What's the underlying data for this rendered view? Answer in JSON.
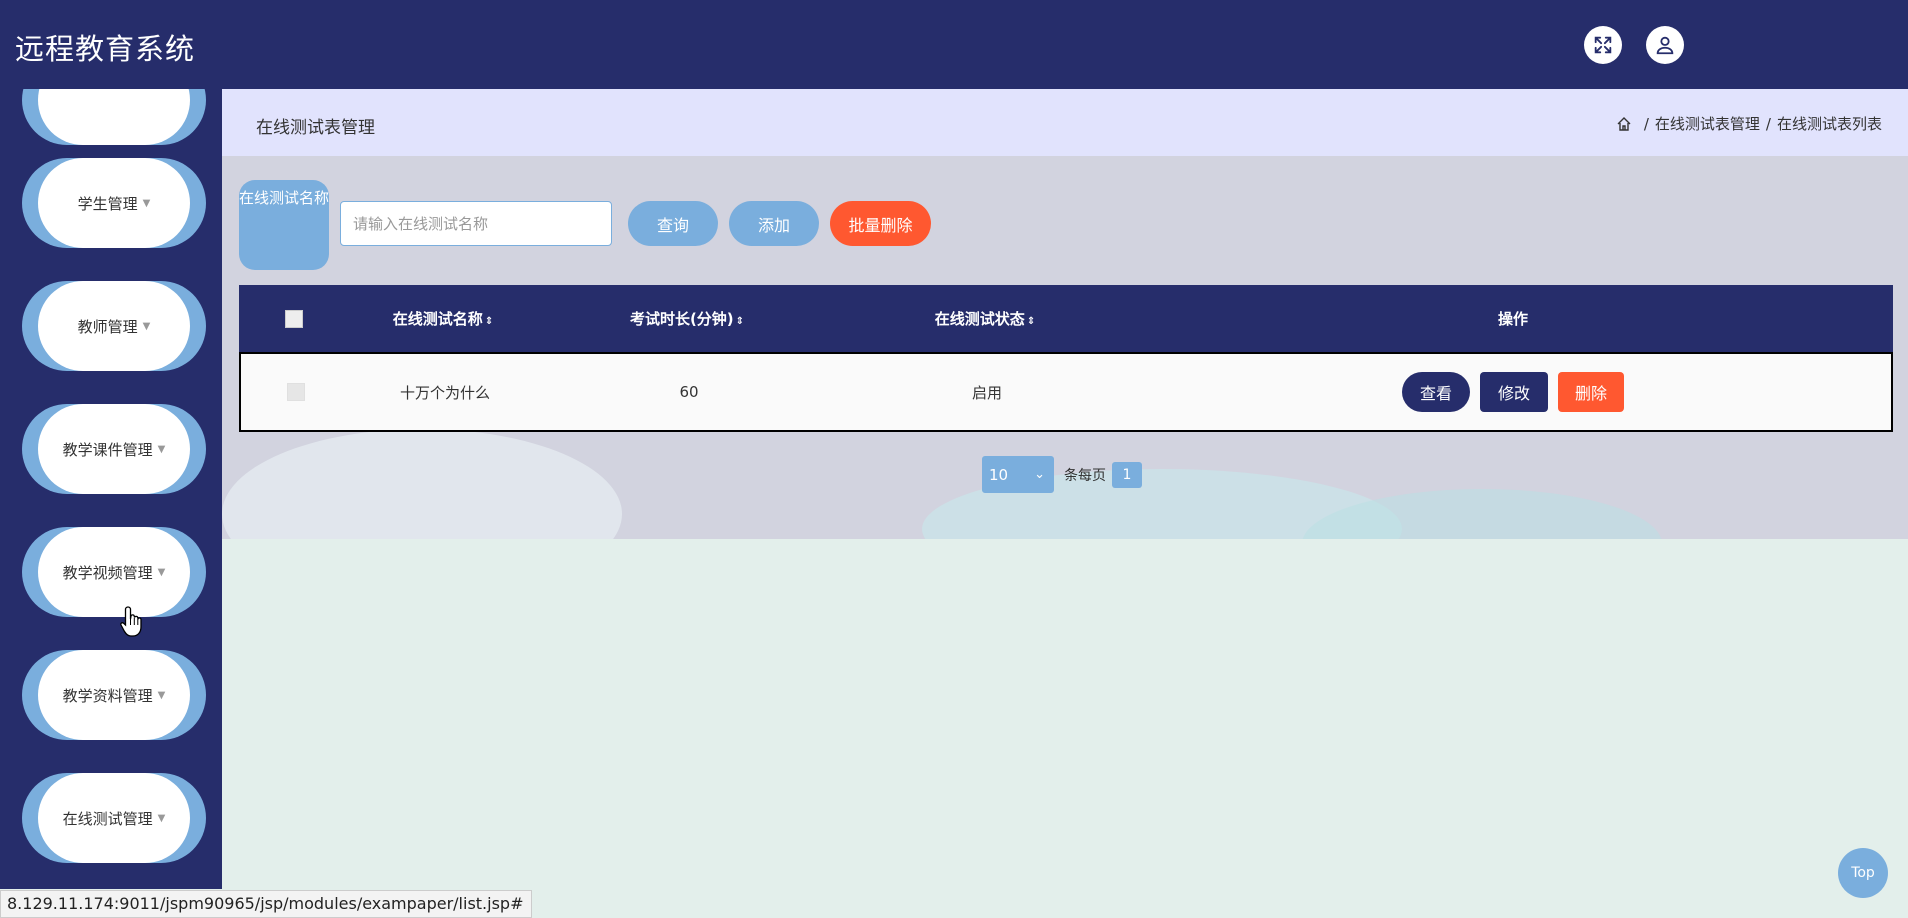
{
  "header": {
    "title": "远程教育系统"
  },
  "sidebar": {
    "items": [
      {
        "label": ""
      },
      {
        "label": "学生管理"
      },
      {
        "label": "教师管理"
      },
      {
        "label": "教学课件管理"
      },
      {
        "label": "教学视频管理"
      },
      {
        "label": "教学资料管理"
      },
      {
        "label": "在线测试管理"
      }
    ]
  },
  "page": {
    "title": "在线测试表管理",
    "breadcrumb": [
      "在线测试表管理",
      "在线测试表列表"
    ]
  },
  "search": {
    "label": "在线测试名称",
    "placeholder": "请输入在线测试名称",
    "query_label": "查询",
    "add_label": "添加",
    "bulk_delete_label": "批量删除"
  },
  "table": {
    "columns": [
      "在线测试名称",
      "考试时长(分钟)",
      "在线测试状态",
      "操作"
    ],
    "rows": [
      {
        "name": "十万个为什么",
        "duration": "60",
        "status": "启用"
      }
    ],
    "actions": {
      "view": "查看",
      "edit": "修改",
      "delete": "删除"
    }
  },
  "pagination": {
    "page_size": "10",
    "per_page_label": "条每页",
    "current_page": "1"
  },
  "status_bar": {
    "url": "8.129.11.174:9011/jspm90965/jsp/modules/exampaper/list.jsp#"
  },
  "top_button": {
    "label": "Top"
  },
  "colors": {
    "primary": "#262d6b",
    "accent": "#7aaedd",
    "danger": "#ff5830",
    "header_bg": "#e1e3fd"
  },
  "icons": [
    "fullscreen-icon",
    "user-icon",
    "home-icon",
    "sort-icon",
    "chevron-down-icon",
    "hand-cursor-icon"
  ]
}
